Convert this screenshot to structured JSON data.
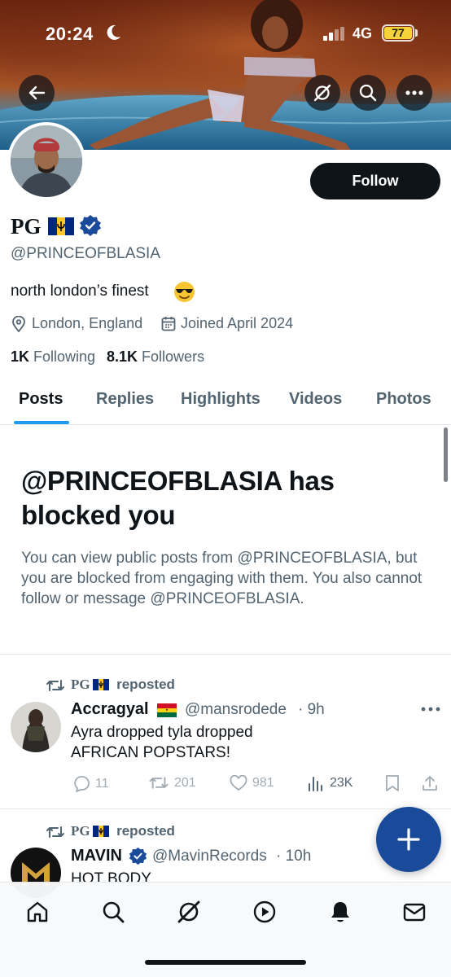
{
  "status_bar": {
    "time": "20:24",
    "network": "4G",
    "battery": "77"
  },
  "profile": {
    "display_name": "PG",
    "handle": "@PRINCEOFBLASIA",
    "bio": "north london’s finest",
    "location": "London, England",
    "joined": "Joined April 2024",
    "following_count": "1K",
    "following_label": "Following",
    "followers_count": "8.1K",
    "followers_label": "Followers",
    "follow_label": "Follow"
  },
  "tabs": [
    {
      "label": "Posts",
      "active": true
    },
    {
      "label": "Replies"
    },
    {
      "label": "Highlights"
    },
    {
      "label": "Videos"
    },
    {
      "label": "Photos"
    }
  ],
  "blocked": {
    "title": "@PRINCEOFBLASIA has blocked you",
    "body": "You can view public posts from @PRINCEOFBLASIA, but you are blocked from engaging with them. You also cannot follow or message @PRINCEOFBLASIA."
  },
  "posts": [
    {
      "repost_by": "PG",
      "repost_label": "reposted",
      "author": "Accragyal",
      "handle": "@mansrodede",
      "time": "· 9h",
      "text": "Ayra dropped tyla dropped\nAFRICAN POPSTARS!",
      "replies": "11",
      "reposts": "201",
      "likes": "981",
      "views": "23K"
    },
    {
      "repost_by": "PG",
      "repost_label": "reposted",
      "author": "MAVIN",
      "handle": "@MavinRecords",
      "time": "· 10h",
      "text": "HOT BODY"
    }
  ],
  "icons": {
    "back": "arrow-left-icon",
    "grok": "grok-icon",
    "search": "search-icon",
    "more": "more-icon",
    "verified": "verified-badge-icon",
    "location": "location-pin-icon",
    "calendar": "calendar-icon",
    "compose": "plus-icon",
    "nav": [
      "home-icon",
      "search-icon",
      "grok-icon",
      "video-play-icon",
      "notifications-bell-icon",
      "messages-envelope-icon"
    ]
  },
  "colors": {
    "accent": "#1d9bf0",
    "fab": "#1a4b9b",
    "follow_button": "#0f1419",
    "battery": "#f7d33a"
  }
}
